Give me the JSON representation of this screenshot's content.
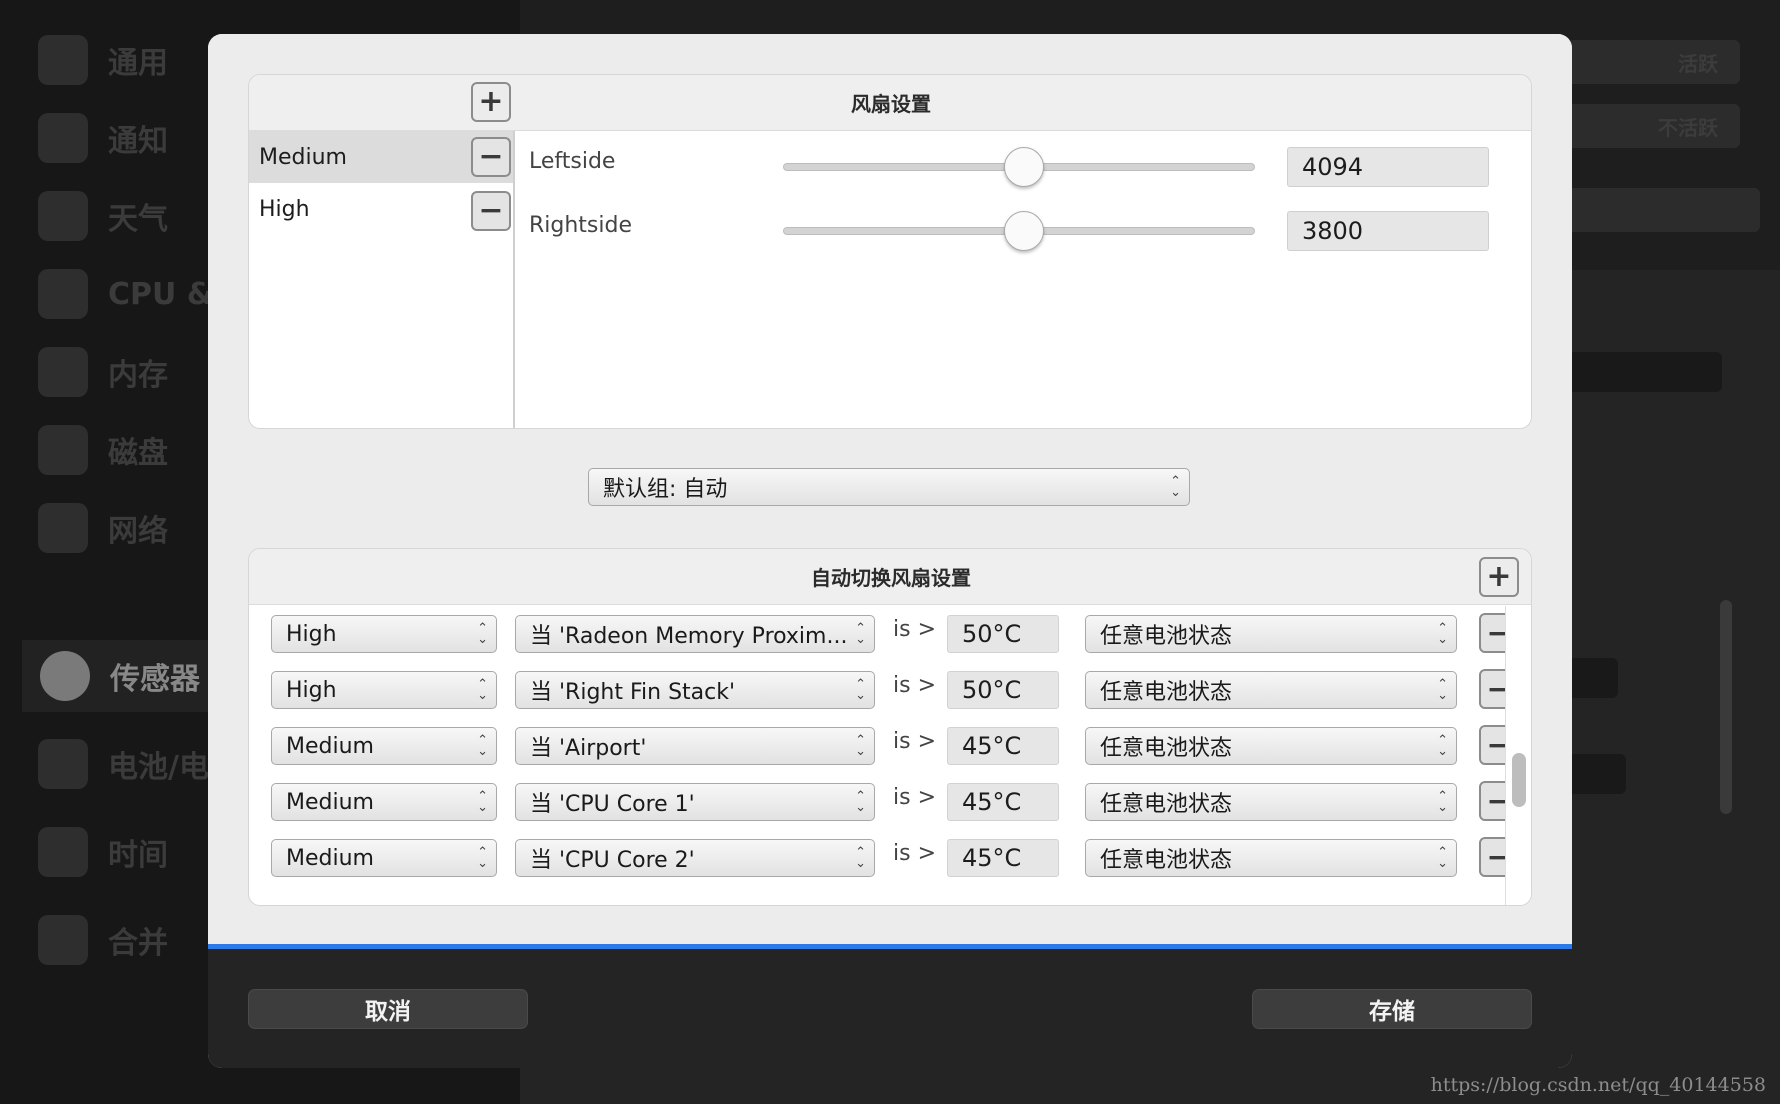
{
  "background": {
    "sidebar": [
      {
        "label": "通用",
        "icon": "gear-icon"
      },
      {
        "label": "通知",
        "icon": "bell-icon"
      },
      {
        "label": "天气",
        "icon": "weather-icon"
      },
      {
        "label": "CPU & G",
        "icon": "cpu-icon"
      },
      {
        "label": "内存",
        "icon": "memory-icon"
      },
      {
        "label": "磁盘",
        "icon": "disk-icon"
      },
      {
        "label": "网络",
        "icon": "network-icon"
      },
      {
        "label": "传感器",
        "icon": "sensor-icon",
        "active": true
      },
      {
        "label": "电池/电",
        "icon": "battery-icon"
      },
      {
        "label": "时间",
        "icon": "clock-icon"
      },
      {
        "label": "合并",
        "icon": "combine-icon"
      }
    ],
    "status_active": "活跃",
    "status_inactive": "不活跃"
  },
  "fan_settings": {
    "title": "风扇设置",
    "profiles": [
      {
        "name": "Medium",
        "selected": true
      },
      {
        "name": "High",
        "selected": false
      }
    ],
    "fans": [
      {
        "name": "Leftside",
        "rpm": "4094",
        "level": 0.51
      },
      {
        "name": "Rightside",
        "rpm": "3800",
        "level": 0.51
      }
    ]
  },
  "default_group": "默认组: 自动",
  "auto_switch": {
    "title": "自动切换风扇设置",
    "condition_word": "is >",
    "rules": [
      {
        "level": "High",
        "sensor": "当 'Radeon Memory Proxim...",
        "temp": "50°C",
        "battery": "任意电池状态"
      },
      {
        "level": "High",
        "sensor": "当 'Right Fin Stack'",
        "temp": "50°C",
        "battery": "任意电池状态"
      },
      {
        "level": "Medium",
        "sensor": "当 'Airport'",
        "temp": "45°C",
        "battery": "任意电池状态"
      },
      {
        "level": "Medium",
        "sensor": "当 'CPU Core 1'",
        "temp": "45°C",
        "battery": "任意电池状态"
      },
      {
        "level": "Medium",
        "sensor": "当 'CPU Core 2'",
        "temp": "45°C",
        "battery": "任意电池状态"
      }
    ]
  },
  "buttons": {
    "cancel": "取消",
    "save": "存储"
  },
  "watermark": "https://blog.csdn.net/qq_40144558",
  "colors": {
    "accent": "#2a7be8",
    "dialog_bg": "#ececec",
    "footer_bg": "#242424"
  }
}
